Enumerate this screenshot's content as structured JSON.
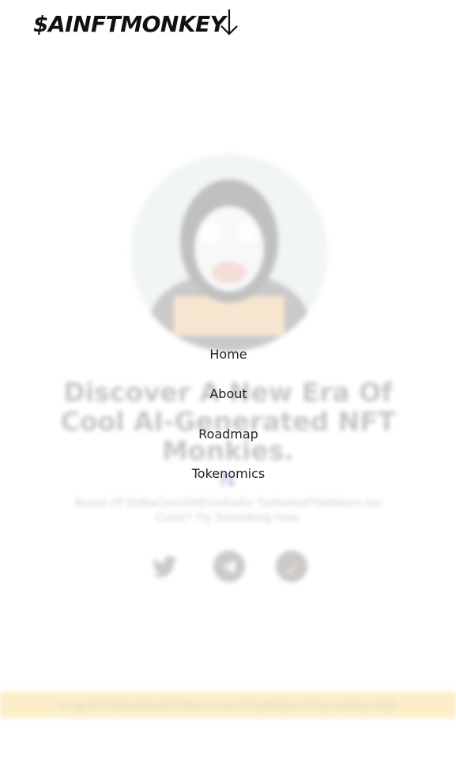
{
  "header": {
    "logo_text": "$AINFTMONKEY",
    "menu_icon": "arrow-down-icon"
  },
  "nav": {
    "items": [
      {
        "label": "Home"
      },
      {
        "label": "About"
      },
      {
        "label": "Roadmap"
      },
      {
        "label": "Tokenomics"
      }
    ]
  },
  "hero": {
    "title": "Discover A New Era Of Cool AI-Generated NFT Monkies.",
    "symbol": "N",
    "subtitle": "Bored Of ShibaCumGMElonKishu TurboAssFlokiMoon Inu Coins? Try Something New."
  },
  "social": {
    "items": [
      {
        "icon": "twitter-icon"
      },
      {
        "icon": "telegram-icon"
      },
      {
        "icon": "dex-icon"
      }
    ]
  },
  "contract": {
    "address": "CLugUb2GDj3oK8hpU8Jh3DwnCenterTPqUB2QwrTDTyhnpdsNpU8Jgh"
  },
  "colors": {
    "accent_yellow": "#f5c542",
    "text_dark": "#111111",
    "symbol_blue": "#2b2bd1"
  }
}
